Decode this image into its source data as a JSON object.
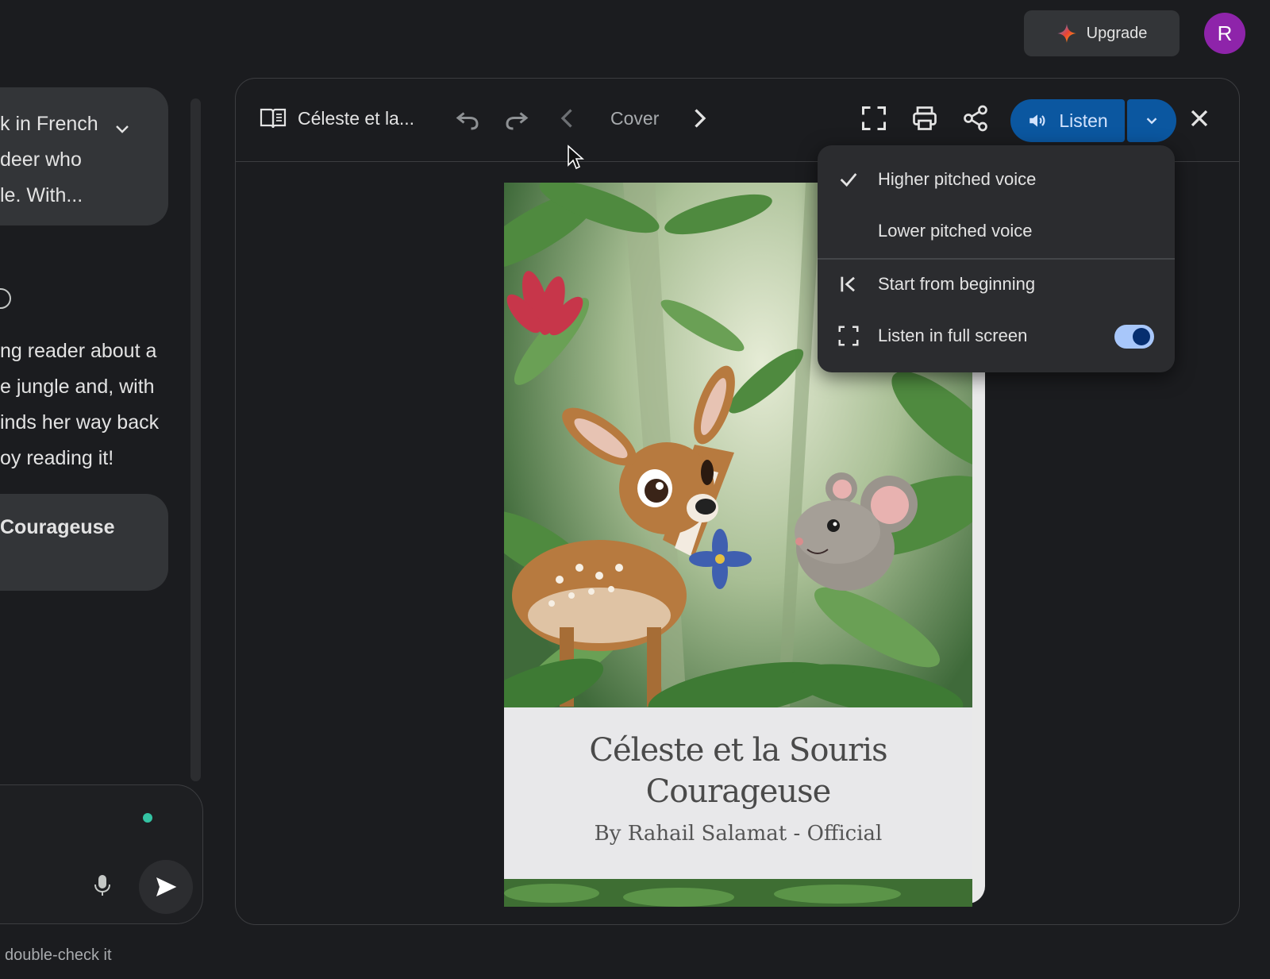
{
  "header": {
    "upgrade_label": "Upgrade",
    "avatar_letter": "R"
  },
  "chat": {
    "prompt_lines": [
      "k in French",
      "deer who",
      "le. With..."
    ],
    "response_lines": [
      "ng reader about a",
      "e jungle and, with",
      "inds her way back",
      "oy reading it!"
    ],
    "attachment_label": "Courageuse",
    "disclaimer": "double-check it"
  },
  "canvas": {
    "doc_title": "Céleste et la...",
    "page_label": "Cover",
    "listen_label": "Listen",
    "book": {
      "title_line1": "Céleste et la Souris",
      "title_line2": "Courageuse",
      "author": "By Rahail Salamat - Official"
    }
  },
  "listen_menu": {
    "items": [
      {
        "label": "Higher pitched voice",
        "checked": true
      },
      {
        "label": "Lower pitched voice",
        "checked": false
      },
      {
        "label": "Start from beginning",
        "icon": "skip-to-start-icon"
      },
      {
        "label": "Listen in full screen",
        "icon": "fullscreen-icon",
        "toggle_on": true
      }
    ]
  },
  "colors": {
    "background": "#1b1c1f",
    "accent": "#0b57a0",
    "avatar": "#8e24aa",
    "toggle_track": "#a8c7fa"
  }
}
